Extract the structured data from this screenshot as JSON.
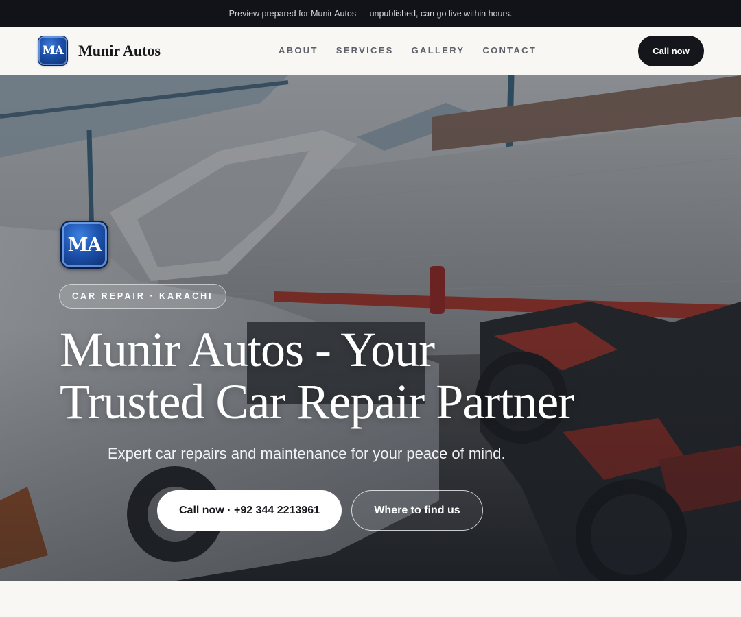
{
  "preview_banner": {
    "text": "Preview prepared for Munir Autos — unpublished, can go live within hours."
  },
  "header": {
    "logo_text": "MA",
    "brand_name": "Munir Autos",
    "nav": [
      {
        "label": "ABOUT"
      },
      {
        "label": "SERVICES"
      },
      {
        "label": "GALLERY"
      },
      {
        "label": "CONTACT"
      }
    ],
    "call_button": "Call now"
  },
  "hero": {
    "logo_text": "MA",
    "tag": "CAR REPAIR · KARACHI",
    "headline_line1": "Munir Autos - Your",
    "headline_line2": "Trusted Car Repair Partner",
    "subheadline": "Expert car repairs and maintenance for your peace of mind.",
    "primary_button": "Call now · +92 344 2213961",
    "secondary_button": "Where to find us",
    "background_image": "workshop-photo"
  },
  "colors": {
    "dark": "#14161b",
    "logo_blue": "#1b4ea6",
    "page_bg": "#f8f7f4"
  }
}
